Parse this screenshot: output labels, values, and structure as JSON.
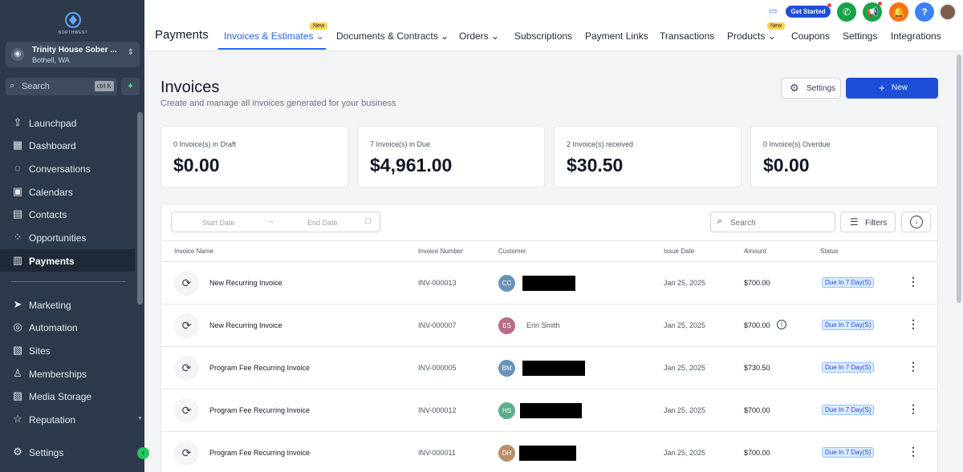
{
  "sidebar": {
    "logo_text": "NORTHWEST",
    "account": {
      "name": "Trinity House Sober ...",
      "location": "Bothell, WA"
    },
    "search": {
      "placeholder": "Search",
      "shortcut": "ctrl K"
    },
    "items": [
      {
        "label": "Launchpad",
        "icon": "rocket-icon"
      },
      {
        "label": "Dashboard",
        "icon": "grid-icon"
      },
      {
        "label": "Conversations",
        "icon": "chat-icon"
      },
      {
        "label": "Calendars",
        "icon": "calendar-icon"
      },
      {
        "label": "Contacts",
        "icon": "contacts-icon"
      },
      {
        "label": "Opportunities",
        "icon": "opportunities-icon"
      },
      {
        "label": "Payments",
        "icon": "payments-icon"
      },
      {
        "label": "Marketing",
        "icon": "send-icon"
      },
      {
        "label": "Automation",
        "icon": "automation-icon"
      },
      {
        "label": "Sites",
        "icon": "sites-icon"
      },
      {
        "label": "Memberships",
        "icon": "memberships-icon"
      },
      {
        "label": "Media Storage",
        "icon": "image-icon"
      },
      {
        "label": "Reputation",
        "icon": "star-icon"
      }
    ],
    "settings_label": "Settings"
  },
  "topbar": {
    "title": "Payments",
    "tabs": [
      {
        "label": "Invoices & Estimates"
      },
      {
        "label": "Documents & Contracts"
      },
      {
        "label": "Orders"
      },
      {
        "label": "Subscriptions"
      },
      {
        "label": "Payment Links"
      },
      {
        "label": "Transactions"
      },
      {
        "label": "Products"
      },
      {
        "label": "Coupons"
      },
      {
        "label": "Settings"
      },
      {
        "label": "Integrations"
      }
    ],
    "new_badge": "New",
    "get_started": "Get Started",
    "help": "?"
  },
  "main": {
    "title": "Invoices",
    "subtitle": "Create and manage all invoices generated for your business",
    "settings_button": "Settings",
    "new_button": "New",
    "cards": [
      {
        "label": "0 Invoice(s) in Draft",
        "value": "$0.00"
      },
      {
        "label": "7 Invoice(s) in Due",
        "value": "$4,961.00"
      },
      {
        "label": "2 Invoice(s) received",
        "value": "$30.50"
      },
      {
        "label": "0 Invoice(s) Overdue",
        "value": "$0.00"
      }
    ],
    "filters": {
      "start_date": "Start Date",
      "end_date": "End Date",
      "search_placeholder": "Search",
      "filters_button": "Filters"
    },
    "table": {
      "columns": [
        "Invoice Name",
        "Invoice Number",
        "Customer",
        "Issue Date",
        "Amount",
        "Status"
      ],
      "rows": [
        {
          "name": "New Recurring Invoice",
          "number": "INV-000013",
          "initials": "CC",
          "avatar_color": "#6b93b8",
          "customer": "",
          "date": "Jan 25, 2025",
          "amount": "$700.00",
          "status": "Due In 7 Day(S)"
        },
        {
          "name": "New Recurring Invoice",
          "number": "INV-000007",
          "initials": "ES",
          "avatar_color": "#b86b8a",
          "customer": "Erin Smith",
          "date": "Jan 25, 2025",
          "amount": "$700.00",
          "status": "Due In 7 Day(S)"
        },
        {
          "name": "Program Fee Recurring Invoice",
          "number": "INV-000005",
          "initials": "BM",
          "avatar_color": "#6b93b8",
          "customer": "",
          "date": "Jan 25, 2025",
          "amount": "$730.50",
          "status": "Due In 7 Day(S)"
        },
        {
          "name": "Program Fee Recurring Invoice",
          "number": "INV-000012",
          "initials": "HS",
          "avatar_color": "#5aae8a",
          "customer": "",
          "date": "Jan 25, 2025",
          "amount": "$700.00",
          "status": "Due In 7 Day(S)"
        },
        {
          "name": "Program Fee Recurring Invoice",
          "number": "INV-000011",
          "initials": "DH",
          "avatar_color": "#b8906b",
          "customer": "",
          "date": "Jan 25, 2025",
          "amount": "$700.00",
          "status": "Due In 7 Day(S)"
        }
      ]
    }
  },
  "colors": {
    "primary": "#1d4ed8",
    "sidebar": "#2c3a4b",
    "accent_green": "#22c55e"
  }
}
